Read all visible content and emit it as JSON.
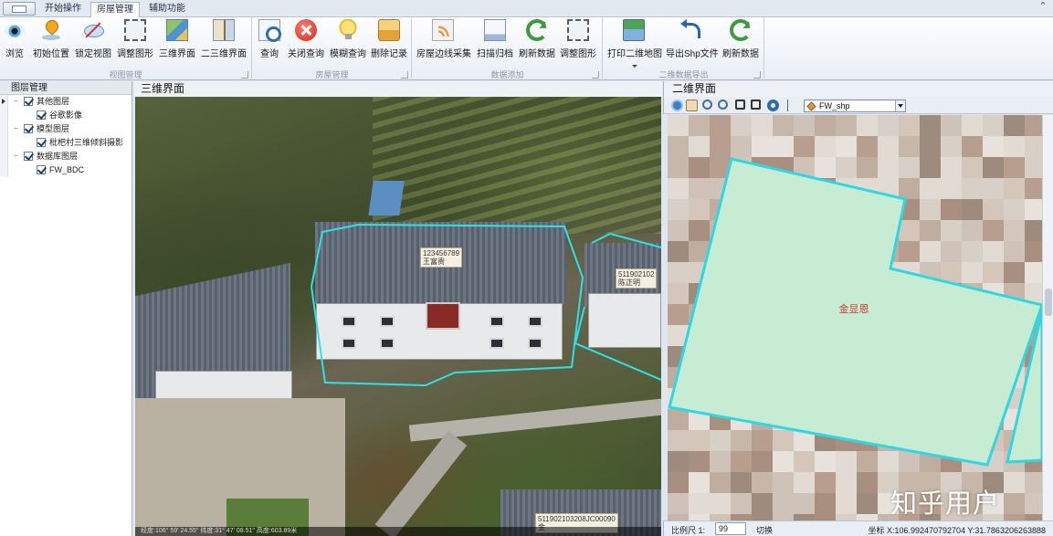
{
  "ribbon": {
    "tabs": [
      {
        "label": "开始操作"
      },
      {
        "label": "房屋管理"
      },
      {
        "label": "辅助功能"
      }
    ],
    "groups": [
      {
        "label": "视图管理",
        "buttons": [
          {
            "label": "浏览",
            "icon": "eye-icon"
          },
          {
            "label": "初始位置",
            "icon": "location-pin-icon"
          },
          {
            "label": "锁定视图",
            "icon": "lock-view-icon"
          },
          {
            "label": "调整图形",
            "icon": "select-rect-icon"
          },
          {
            "label": "三维界面",
            "icon": "map-3d-icon"
          },
          {
            "label": "二三维界面",
            "icon": "split-view-icon"
          }
        ]
      },
      {
        "label": "房屋管理",
        "buttons": [
          {
            "label": "查询",
            "icon": "query-icon"
          },
          {
            "label": "关闭查询",
            "icon": "close-circle-icon"
          },
          {
            "label": "模糊查询",
            "icon": "bulb-icon"
          },
          {
            "label": "删除记录",
            "icon": "delete-record-icon"
          }
        ]
      },
      {
        "label": "数据添加",
        "buttons": [
          {
            "label": "房屋边线采集",
            "icon": "collect-icon"
          },
          {
            "label": "扫描归档",
            "icon": "scan-icon"
          },
          {
            "label": "刷新数据",
            "icon": "refresh-icon"
          },
          {
            "label": "调整图形",
            "icon": "select-rect-icon"
          }
        ]
      },
      {
        "label": "二维数据导出",
        "buttons": [
          {
            "label": "打印二维地图",
            "icon": "print-map-icon"
          },
          {
            "label": "导出Shp文件",
            "icon": "export-icon"
          },
          {
            "label": "刷新数据",
            "icon": "refresh-icon"
          }
        ]
      }
    ]
  },
  "layer_panel": {
    "title": "图层管理",
    "items": [
      {
        "label": "其他图层",
        "level": 0
      },
      {
        "label": "谷歌影像",
        "level": 1
      },
      {
        "label": "模型图层",
        "level": 0
      },
      {
        "label": "枇杷村三维倾斜摄影",
        "level": 1
      },
      {
        "label": "数据库图层",
        "level": 0
      },
      {
        "label": "FW_BDC",
        "level": 1
      }
    ]
  },
  "view3d": {
    "title": "三维界面",
    "labels": [
      {
        "code": "123456789",
        "name": "王富贵"
      },
      {
        "code": "511902102",
        "name": "陈正明"
      },
      {
        "code": "511902103208JC00090",
        "name": "金"
      }
    ],
    "coord_text": "经度:106° 59' 24.55\"    纬度:31° 47' 08.51\"    高度:603.89米"
  },
  "view2d": {
    "title": "二维界面",
    "layer_select": "FW_shp",
    "parcel_label": "金显恩",
    "scale_label": "比例尺 1:",
    "scale_value": "99",
    "switch_label": "切换",
    "coords": "坐标 X:106.992470792704  Y:31.7863206263888"
  },
  "colors": {
    "parcel_fill": "#c6ecd3",
    "parcel_stroke": "#2fd7e2",
    "parcel_label": "#d23a2a"
  },
  "watermark": "知乎用户"
}
